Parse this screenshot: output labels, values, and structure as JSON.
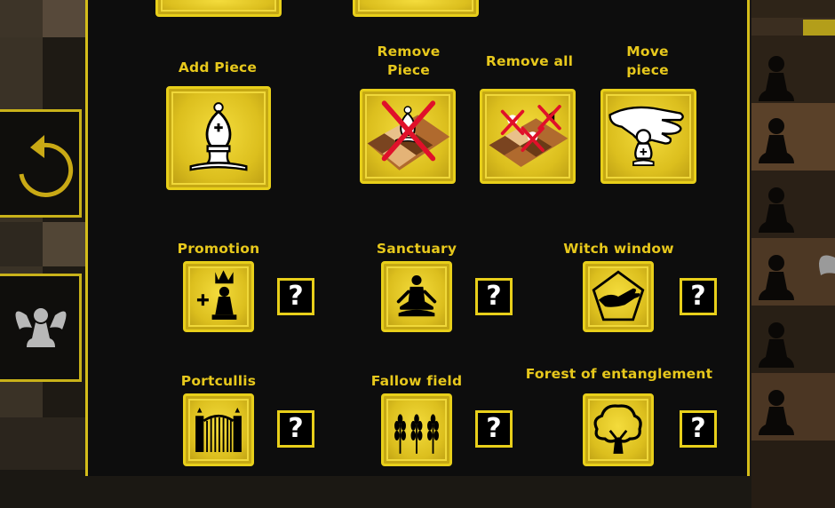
{
  "tools": {
    "add_piece": {
      "label": "Add Piece",
      "icon": "bishop-icon"
    },
    "remove_piece": {
      "label_line1": "Remove",
      "label_line2": "Piece",
      "icon": "remove-piece-icon"
    },
    "remove_all": {
      "label": "Remove all",
      "icon": "remove-all-icon"
    },
    "move_piece": {
      "label_line1": "Move",
      "label_line2": "piece",
      "icon": "hand-move-icon"
    }
  },
  "powers": [
    {
      "label": "Promotion",
      "icon": "promotion-icon",
      "help": "?"
    },
    {
      "label": "Sanctuary",
      "icon": "meditation-icon",
      "help": "?"
    },
    {
      "label": "Witch window",
      "icon": "witch-window-icon",
      "help": "?"
    },
    {
      "label": "Portcullis",
      "icon": "gate-icon",
      "help": "?"
    },
    {
      "label": "Fallow field",
      "icon": "wheat-icon",
      "help": "?"
    },
    {
      "label": "Forest of entanglement",
      "icon": "tree-icon",
      "help": "?"
    }
  ],
  "colors": {
    "accent": "#e7c81c",
    "panel": "#0d0d0d",
    "button_gold": "#dcbf1e",
    "cross": "#e0102a"
  }
}
